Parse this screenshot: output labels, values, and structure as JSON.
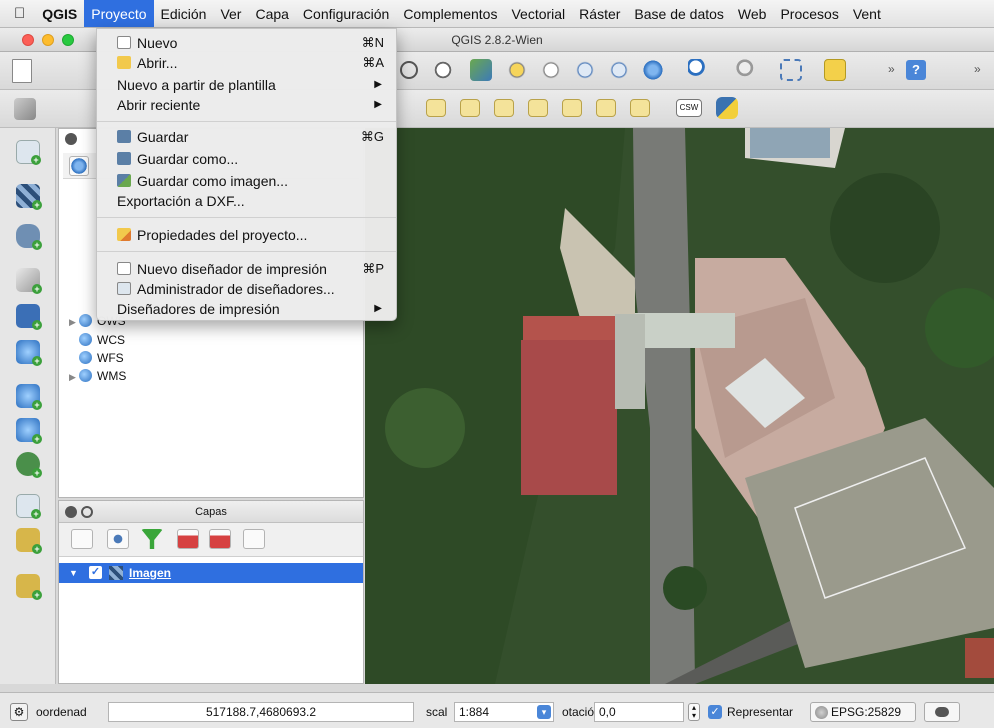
{
  "menubar": {
    "apple": "",
    "items": [
      "QGIS",
      "Proyecto",
      "Edición",
      "Ver",
      "Capa",
      "Configuración",
      "Complementos",
      "Vectorial",
      "Ráster",
      "Base de datos",
      "Web",
      "Procesos",
      "Vent"
    ]
  },
  "window": {
    "title": "QGIS 2.8.2-Wien"
  },
  "toolbar": {
    "labels_csw": "CSW"
  },
  "project_menu": {
    "items": [
      {
        "label": "Nuevo",
        "shortcut": "⌘N",
        "icon": "new-file-icon"
      },
      {
        "label": "Abrir...",
        "shortcut": "⌘A",
        "icon": "folder-icon"
      },
      {
        "label": "Nuevo a partir de plantilla",
        "submenu": true
      },
      {
        "label": "Abrir reciente",
        "submenu": true
      },
      {
        "label": "Guardar",
        "shortcut": "⌘G",
        "icon": "save-icon"
      },
      {
        "label": "Guardar como...",
        "icon": "save-as-icon"
      },
      {
        "label": "Guardar como imagen...",
        "icon": "save-image-icon"
      },
      {
        "label": "Exportación a DXF..."
      },
      {
        "label": "Propiedades del proyecto...",
        "icon": "properties-icon"
      },
      {
        "label": "Nuevo diseñador de impresión",
        "shortcut": "⌘P",
        "icon": "new-composer-icon"
      },
      {
        "label": "Administrador de diseñadores...",
        "icon": "composer-manager-icon"
      },
      {
        "label": "Diseñadores de impresión",
        "submenu": true
      }
    ]
  },
  "browser": {
    "items": [
      "OWS",
      "WCS",
      "WFS",
      "WMS"
    ]
  },
  "layers_panel": {
    "title": "Capas",
    "layer_name": "Imagen",
    "layer_checked": true
  },
  "status_bar": {
    "coord_label": "oordenad",
    "coord_value": "517188.7,4680693.2",
    "scale_label": "scal",
    "scale_value": "1:884",
    "rotation_label": "otació",
    "rotation_value": "0,0",
    "render_label": "Representar",
    "render_checked": true,
    "crs": "EPSG:25829"
  },
  "colors": {
    "accent": "#2f6fe0",
    "roof_red": "#a84a4a",
    "court": "#9a9a8c"
  }
}
